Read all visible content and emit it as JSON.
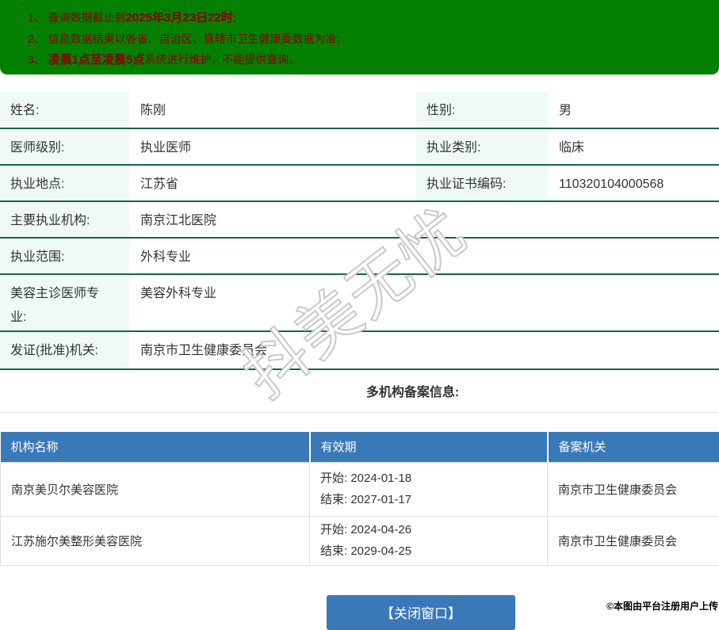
{
  "colors": {
    "banner_bg": "#018001",
    "banner_text": "#8b0000",
    "table_border_green": "#156548",
    "label_cell_bg": "#effaf4",
    "accent_blue": "#3a79b8"
  },
  "notice": {
    "line1_pre": "1、 查询数据截止到",
    "line1_bold": "2025年3月23日22时",
    "line1_post": ";",
    "line2": "2、 信息数据结果以各省、自治区、直辖市卫生健康委数据为准;",
    "line3_pre": "3、 ",
    "line3_bold": "凌晨1点至凌晨5点",
    "line3_post": "系统进行维护，不能提供查询。"
  },
  "doctor_table": {
    "rows": [
      {
        "label1": "姓名:",
        "value1": "陈刚",
        "label2": "性别:",
        "value2": "男"
      },
      {
        "label1": "医师级别:",
        "value1": "执业医师",
        "label2": "执业类别:",
        "value2": "临床"
      },
      {
        "label1": "执业地点:",
        "value1": "江苏省",
        "label2": "执业证书编码:",
        "value2": "110320104000568"
      },
      {
        "label": "主要执业机构:",
        "value": "南京江北医院"
      },
      {
        "label": "执业范围:",
        "value": "外科专业"
      },
      {
        "label": "美容主诊医师专业:",
        "value": "美容外科专业"
      },
      {
        "label": "发证(批准)机关:",
        "value": "南京市卫生健康委员会"
      }
    ]
  },
  "records": {
    "section_title": "多机构备案信息:",
    "headers": [
      "机构名称",
      "有效期",
      "备案机关"
    ],
    "rows": [
      {
        "org": "南京美贝尔美容医院",
        "start": "开始: 2024-01-18",
        "end": "结束: 2027-01-17",
        "authority": "南京市卫生健康委员会"
      },
      {
        "org": "江苏施尔美整形美容医院",
        "start": "开始: 2024-04-26",
        "end": "结束: 2029-04-25",
        "authority": "南京市卫生健康委员会"
      }
    ]
  },
  "footer": {
    "close_button_label": "【关闭窗口】"
  },
  "watermarks": {
    "diagonal": "抖美无忧",
    "upload_credit": "©本图由平台注册用户上传"
  }
}
